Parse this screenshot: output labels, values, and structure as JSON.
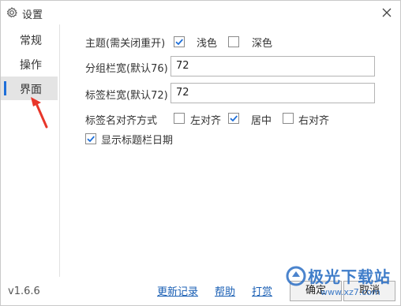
{
  "window": {
    "title": "设置"
  },
  "sidebar": {
    "items": [
      {
        "label": "常规",
        "active": false
      },
      {
        "label": "操作",
        "active": false
      },
      {
        "label": "界面",
        "active": true
      }
    ]
  },
  "settings": {
    "theme": {
      "label": "主题(需关闭重开)",
      "light_label": "浅色",
      "light_checked": true,
      "dark_label": "深色",
      "dark_checked": false
    },
    "group_width": {
      "label": "分组栏宽(默认76)",
      "value": "72"
    },
    "tab_width": {
      "label": "标签栏宽(默认72)",
      "value": "72"
    },
    "tab_align": {
      "label": "标签名对齐方式",
      "left_label": "左对齐",
      "left_checked": false,
      "center_label": "居中",
      "center_checked": true,
      "right_label": "右对齐",
      "right_checked": false
    },
    "show_date": {
      "label": "显示标题栏日期",
      "checked": true
    }
  },
  "footer": {
    "version": "v1.6.6",
    "changelog_link": "更新记录",
    "help_link": "帮助",
    "donate_link": "打赏",
    "ok_button": "确定",
    "cancel_button": "取消"
  },
  "watermark": {
    "text": "极光下载站",
    "url": "www.xz7.com"
  },
  "colors": {
    "accent": "#1e6fd9",
    "check": "#1e6fd9",
    "annotation_arrow": "#e8362a"
  }
}
